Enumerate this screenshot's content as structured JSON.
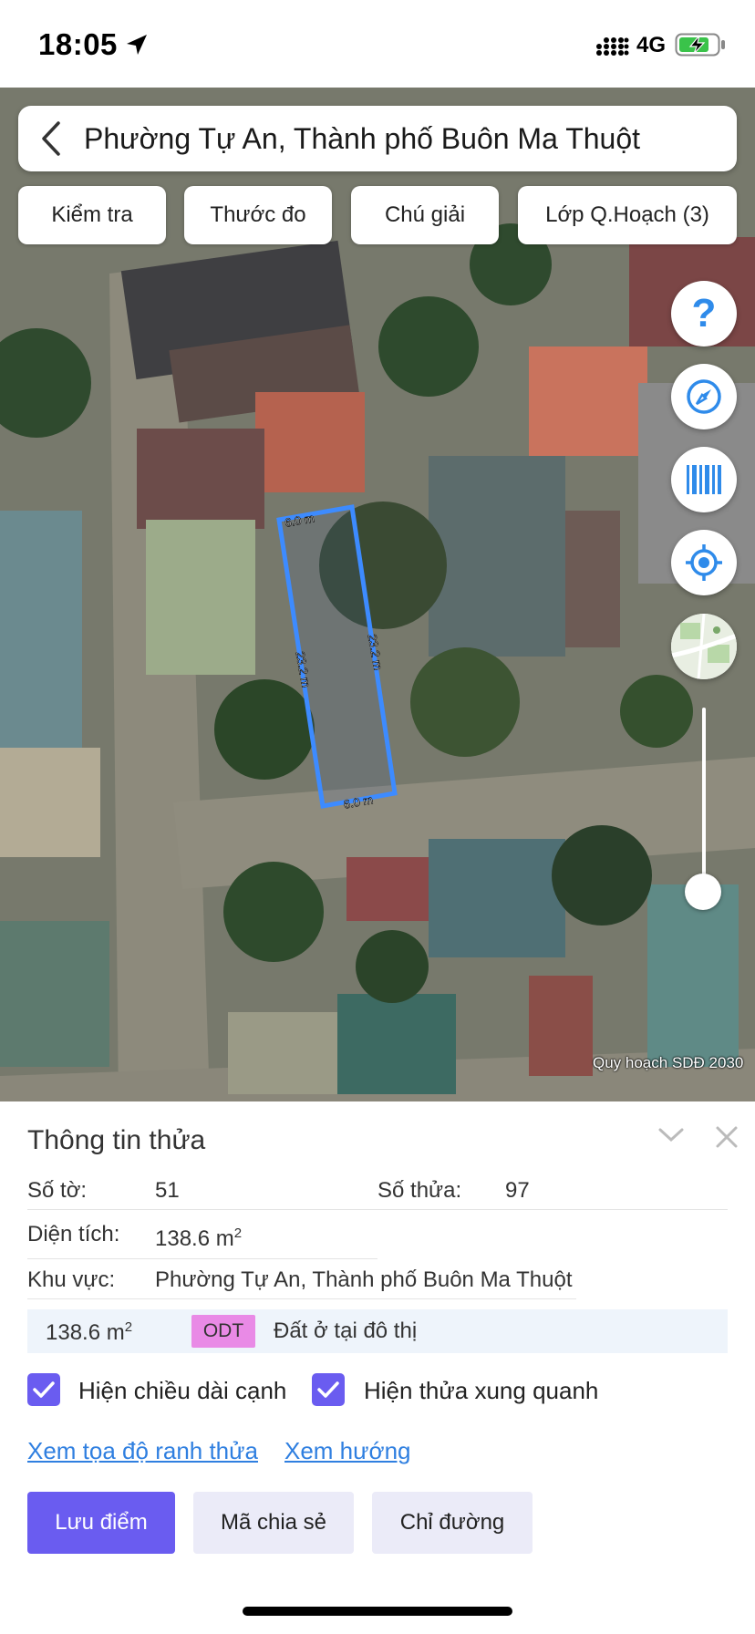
{
  "status_bar": {
    "time": "18:05",
    "network": "4G",
    "icons": [
      "location-arrow-icon",
      "signal-icon",
      "battery-charging-icon"
    ]
  },
  "search": {
    "title": "Phường Tự An, Thành phố Buôn Ma Thuột"
  },
  "tools": [
    "Kiểm tra",
    "Thước đo",
    "Chú giải",
    "Lớp Q.Hoạch (3)"
  ],
  "map": {
    "parcel_edges": {
      "top": "6.0 m",
      "left": "23.2 m",
      "right": "23.2 m",
      "bottom": "6.0 m"
    },
    "watermark": "Quy hoạch SDĐ 2030",
    "parcel_color": "#3d8bff",
    "zoom_level_fraction": 0.1
  },
  "map_controls": [
    "help-icon",
    "compass-icon",
    "barcode-icon",
    "locate-icon",
    "map-thumbnail-icon"
  ],
  "panel": {
    "title": "Thông tin thửa",
    "so_to_label": "Số tờ:",
    "so_to_value": "51",
    "so_thua_label": "Số thửa:",
    "so_thua_value": "97",
    "dien_tich_label": "Diện tích:",
    "dien_tich_value": "138.6 m",
    "dien_tich_unit_sup": "2",
    "khu_vuc_label": "Khu vực:",
    "khu_vuc_value": "Phường Tự An, Thành phố Buôn Ma Thuột",
    "land_use": {
      "area": "138.6 m",
      "area_sup": "2",
      "code": "ODT",
      "description": "Đất ở tại đô thị",
      "badge_color": "#e98ae6"
    },
    "checkbox_edge_length": {
      "label": "Hiện chiều dài cạnh",
      "checked": true
    },
    "checkbox_neighbors": {
      "label": "Hiện thửa xung quanh",
      "checked": true
    },
    "link_coordinates": "Xem tọa độ ranh thửa",
    "link_direction": "Xem hướng",
    "btn_save": "Lưu điểm",
    "btn_share": "Mã chia sẻ",
    "btn_directions": "Chỉ đường"
  },
  "colors": {
    "accent": "#6a5cf0",
    "link": "#2f7fe0",
    "map_control_blue": "#2f8bea"
  }
}
